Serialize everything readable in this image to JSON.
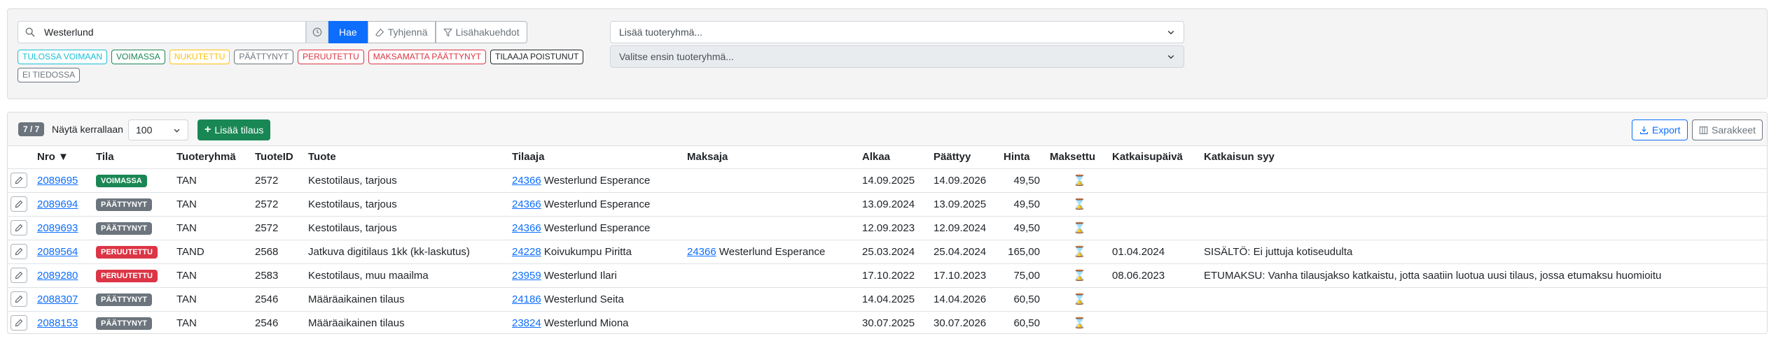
{
  "colors": {
    "primary": "#0d6efd",
    "success": "#198754",
    "danger": "#dc3545",
    "secondary": "#6c757d",
    "hourglass": "#f0ad00"
  },
  "search": {
    "value": "Westerlund",
    "search_button": "Hae",
    "clear_button": "Tyhjennä",
    "more_filters_button": "Lisähakuehdot"
  },
  "status_filters": [
    {
      "label": "TULOSSA VOIMAAN",
      "color": "#17c1d6"
    },
    {
      "label": "VOIMASSA",
      "color": "#198754"
    },
    {
      "label": "NUKUTETTU",
      "color": "#ffc107"
    },
    {
      "label": "PÄÄTTYNYT",
      "color": "#6c757d"
    },
    {
      "label": "PERUUTETTU",
      "color": "#dc3545"
    },
    {
      "label": "MAKSAMATTA PÄÄTTYNYT",
      "color": "#dc3545"
    },
    {
      "label": "TILAAJA POISTUNUT",
      "color": "#212529"
    },
    {
      "label": "EI TIEDOSSA",
      "color": "#6c757d"
    }
  ],
  "product_group_select": {
    "placeholder": "Lisää tuoteryhmä..."
  },
  "product_select": {
    "placeholder": "Valitse ensin tuoteryhmä..."
  },
  "results": {
    "count": "7 / 7",
    "per_page_label": "Näytä kerrallaan",
    "per_page_value": "100",
    "add_button": "Lisää tilaus",
    "export_button": "Export",
    "columns_button": "Sarakkeet"
  },
  "table": {
    "headers": {
      "nro": "Nro ▼",
      "tila": "Tila",
      "tuoteryhma": "Tuoteryhmä",
      "tuoteid": "TuoteID",
      "tuote": "Tuote",
      "tilaaja": "Tilaaja",
      "maksaja": "Maksaja",
      "alkaa": "Alkaa",
      "paattyy": "Päättyy",
      "hinta": "Hinta",
      "maksettu": "Maksettu",
      "katkaisupaiva": "Katkaisupäivä",
      "katkaisun_syy": "Katkaisun syy"
    },
    "rows": [
      {
        "nro": "2089695",
        "tila": "VOIMASSA",
        "tila_color": "#198754",
        "tuoteryhma": "TAN",
        "tuoteid": "2572",
        "tuote": "Kestotilaus, tarjous",
        "tilaaja_id": "24366",
        "tilaaja_name": "Westerlund Esperance",
        "maksaja_id": "",
        "maksaja_name": "",
        "alkaa": "14.09.2025",
        "paattyy": "14.09.2026",
        "hinta": "49,50",
        "maksettu": "⌛",
        "katkaisupaiva": "",
        "katkaisun_syy": ""
      },
      {
        "nro": "2089694",
        "tila": "PÄÄTTYNYT",
        "tila_color": "#6c757d",
        "tuoteryhma": "TAN",
        "tuoteid": "2572",
        "tuote": "Kestotilaus, tarjous",
        "tilaaja_id": "24366",
        "tilaaja_name": "Westerlund Esperance",
        "maksaja_id": "",
        "maksaja_name": "",
        "alkaa": "13.09.2024",
        "paattyy": "13.09.2025",
        "hinta": "49,50",
        "maksettu": "⌛",
        "katkaisupaiva": "",
        "katkaisun_syy": ""
      },
      {
        "nro": "2089693",
        "tila": "PÄÄTTYNYT",
        "tila_color": "#6c757d",
        "tuoteryhma": "TAN",
        "tuoteid": "2572",
        "tuote": "Kestotilaus, tarjous",
        "tilaaja_id": "24366",
        "tilaaja_name": "Westerlund Esperance",
        "maksaja_id": "",
        "maksaja_name": "",
        "alkaa": "12.09.2023",
        "paattyy": "12.09.2024",
        "hinta": "49,50",
        "maksettu": "⌛",
        "katkaisupaiva": "",
        "katkaisun_syy": ""
      },
      {
        "nro": "2089564",
        "tila": "PERUUTETTU",
        "tila_color": "#dc3545",
        "tuoteryhma": "TAND",
        "tuoteid": "2568",
        "tuote": "Jatkuva digitilaus 1kk (kk-laskutus)",
        "tilaaja_id": "24228",
        "tilaaja_name": "Koivukumpu Piritta",
        "maksaja_id": "24366",
        "maksaja_name": "Westerlund Esperance",
        "alkaa": "25.03.2024",
        "paattyy": "25.04.2024",
        "hinta": "165,00",
        "maksettu": "⌛",
        "katkaisupaiva": "01.04.2024",
        "katkaisun_syy": "SISÄLTÖ: Ei juttuja kotiseudulta"
      },
      {
        "nro": "2089280",
        "tila": "PERUUTETTU",
        "tila_color": "#dc3545",
        "tuoteryhma": "TAN",
        "tuoteid": "2583",
        "tuote": "Kestotilaus, muu maailma",
        "tilaaja_id": "23959",
        "tilaaja_name": "Westerlund Ilari",
        "maksaja_id": "",
        "maksaja_name": "",
        "alkaa": "17.10.2022",
        "paattyy": "17.10.2023",
        "hinta": "75,00",
        "maksettu": "⌛",
        "katkaisupaiva": "08.06.2023",
        "katkaisun_syy": "ETUMAKSU: Vanha tilausjakso katkaistu, jotta saatiin luotua uusi tilaus, jossa etumaksu huomioitu"
      },
      {
        "nro": "2088307",
        "tila": "PÄÄTTYNYT",
        "tila_color": "#6c757d",
        "tuoteryhma": "TAN",
        "tuoteid": "2546",
        "tuote": "Määräaikainen tilaus",
        "tilaaja_id": "24186",
        "tilaaja_name": "Westerlund Seita",
        "maksaja_id": "",
        "maksaja_name": "",
        "alkaa": "14.04.2025",
        "paattyy": "14.04.2026",
        "hinta": "60,50",
        "maksettu": "⌛",
        "katkaisupaiva": "",
        "katkaisun_syy": ""
      },
      {
        "nro": "2088153",
        "tila": "PÄÄTTYNYT",
        "tila_color": "#6c757d",
        "tuoteryhma": "TAN",
        "tuoteid": "2546",
        "tuote": "Määräaikainen tilaus",
        "tilaaja_id": "23824",
        "tilaaja_name": "Westerlund Miona",
        "maksaja_id": "",
        "maksaja_name": "",
        "alkaa": "30.07.2025",
        "paattyy": "30.07.2026",
        "hinta": "60,50",
        "maksettu": "⌛",
        "katkaisupaiva": "",
        "katkaisun_syy": ""
      }
    ]
  }
}
